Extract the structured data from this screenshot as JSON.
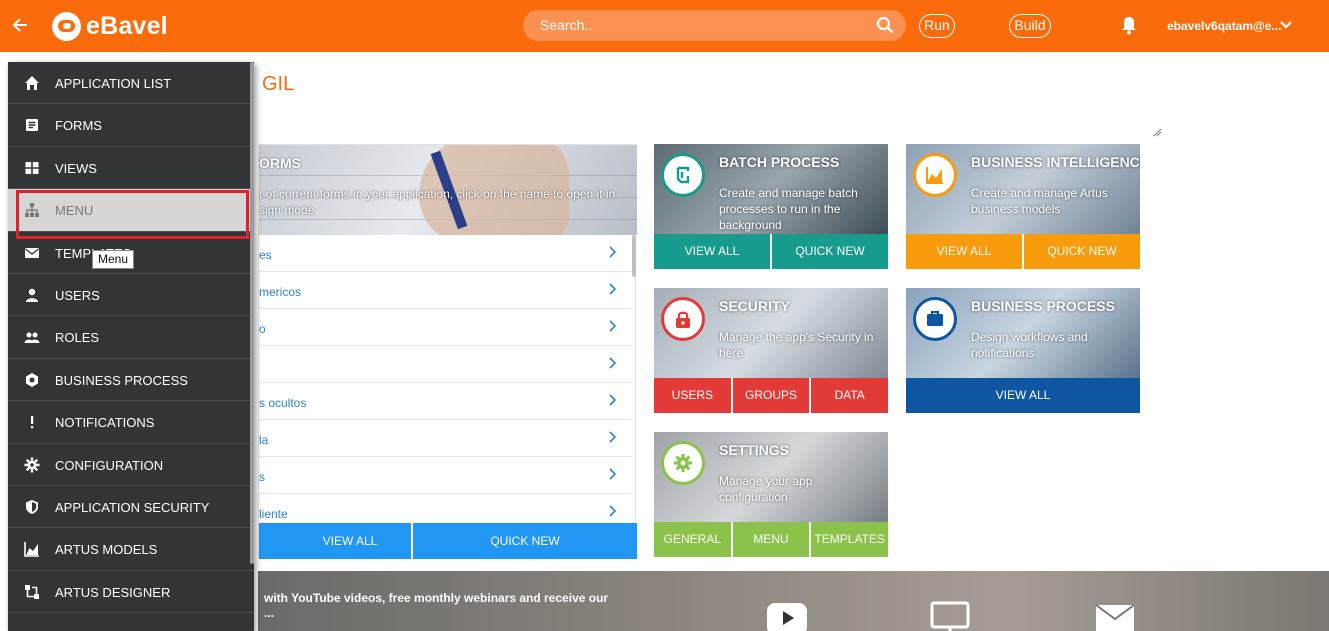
{
  "header": {
    "brand": "eBavel",
    "search_placeholder": "Search..",
    "run_label": "Run",
    "build_label": "Build",
    "user": "ebavelv6qatam@e..."
  },
  "page": {
    "title": "GIL"
  },
  "forms_card": {
    "title": "ORMS",
    "description": "t of current forms in your application, click on the name to open it in sign mode",
    "rows": [
      "es",
      "mericos",
      "o",
      "",
      "s ocultos",
      "la",
      "s",
      "liente"
    ],
    "view_all": "VIEW ALL",
    "quick_new": "QUICK NEW"
  },
  "tiles": {
    "batch": {
      "title": "BATCH PROCESS",
      "desc": "Create and manage batch processes to run in the background",
      "btn1": "VIEW ALL",
      "btn2": "QUICK NEW",
      "color": "#179b8d"
    },
    "bi": {
      "title": "BUSINESS INTELLIGENCE",
      "desc": "Create and manage Artus business models",
      "btn1": "VIEW ALL",
      "btn2": "QUICK NEW",
      "color": "#f89c0e"
    },
    "security": {
      "title": "SECURITY",
      "desc": "Manage the app's Security in here",
      "btn1": "USERS",
      "btn2": "GROUPS",
      "btn3": "DATA",
      "color": "#e23a36"
    },
    "bp": {
      "title": "BUSINESS PROCESS",
      "desc": "Design workflows and notifications",
      "btn1": "VIEW ALL",
      "color": "#0e56a2"
    },
    "settings": {
      "title": "SETTINGS",
      "desc": "Manage your app configuration",
      "btn1": "GENERAL",
      "btn2": "MENU",
      "btn3": "TEMPLATES",
      "color": "#8bc34a"
    }
  },
  "banner": {
    "text_line1": "with YouTube videos, free monthly webinars and receive our",
    "text_line2": "..."
  },
  "sidemenu": {
    "items": [
      {
        "label": "APPLICATION LIST",
        "icon": "home-icon"
      },
      {
        "label": "FORMS",
        "icon": "form-icon"
      },
      {
        "label": "VIEWS",
        "icon": "grid-icon"
      },
      {
        "label": "MENU",
        "icon": "sitemap-icon"
      },
      {
        "label": "TEMPLATES",
        "icon": "mail-icon"
      },
      {
        "label": "USERS",
        "icon": "user-icon"
      },
      {
        "label": "ROLES",
        "icon": "users-icon"
      },
      {
        "label": "BUSINESS PROCESS",
        "icon": "process-icon"
      },
      {
        "label": "NOTIFICATIONS",
        "icon": "exclamation-icon"
      },
      {
        "label": "CONFIGURATION",
        "icon": "gear-icon"
      },
      {
        "label": "APPLICATION SECURITY",
        "icon": "shield-icon"
      },
      {
        "label": "ARTUS MODELS",
        "icon": "area-chart-icon"
      },
      {
        "label": "ARTUS DESIGNER",
        "icon": "designer-icon"
      }
    ],
    "active_item": "MENU",
    "tooltip": "Menu"
  },
  "colors": {
    "brand": "#fa6c0b",
    "sidebar": "#333436",
    "highlight": "#e3202b",
    "forms_blue": "#2196f3"
  }
}
